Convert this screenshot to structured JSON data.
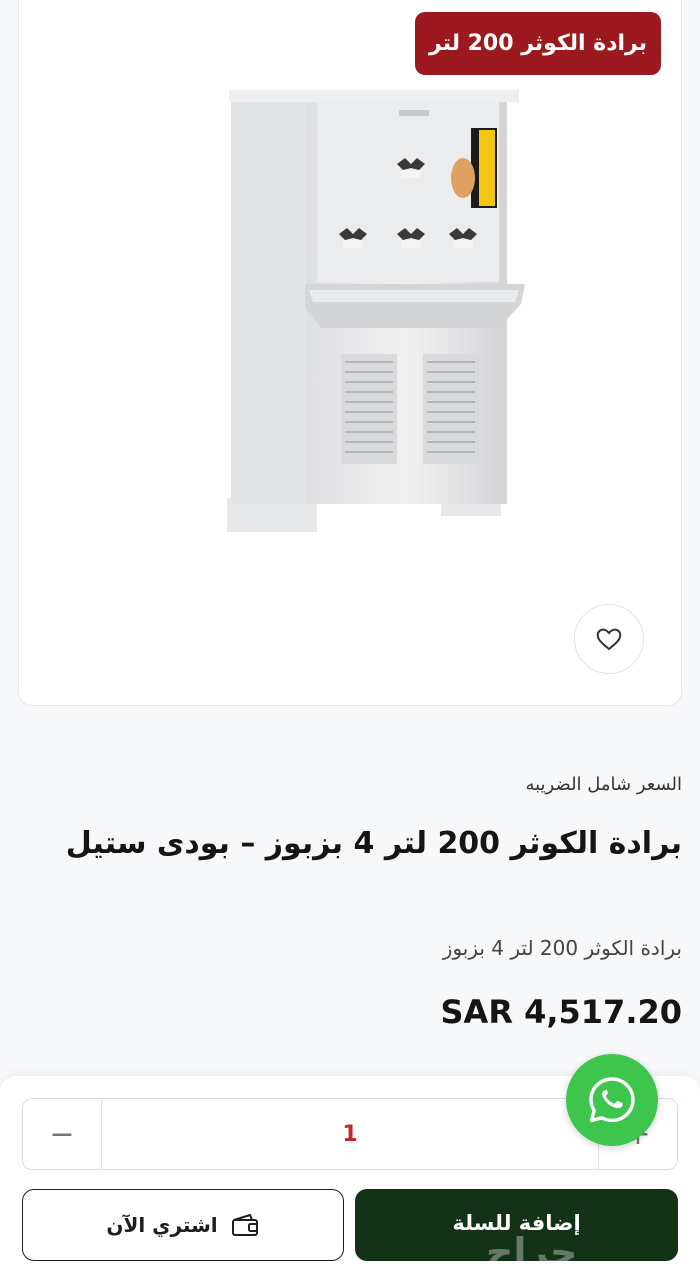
{
  "product": {
    "tag": "برادة الكوثر 200 لتر",
    "tax_note": "السعر شامل الضريبه",
    "title": "برادة الكوثر 200 لتر 4 بزبوز – بودى ستيل",
    "subtitle": "برادة الكوثر 200 لتر 4 بزبوز",
    "price": "SAR 4,517.20"
  },
  "quantity": {
    "value": "1",
    "minus": "−",
    "plus": "+"
  },
  "actions": {
    "add_to_cart": "إضافة للسلة",
    "buy_now": "اشتري الآن"
  },
  "watermark": "حراج",
  "icons": [
    "heart-icon",
    "wallet-icon",
    "whatsapp-icon"
  ],
  "colors": {
    "tag_bg": "#9c1a1f",
    "cart_bg": "#143216",
    "qty_text": "#c1272d",
    "whatsapp": "#3ec54d"
  }
}
